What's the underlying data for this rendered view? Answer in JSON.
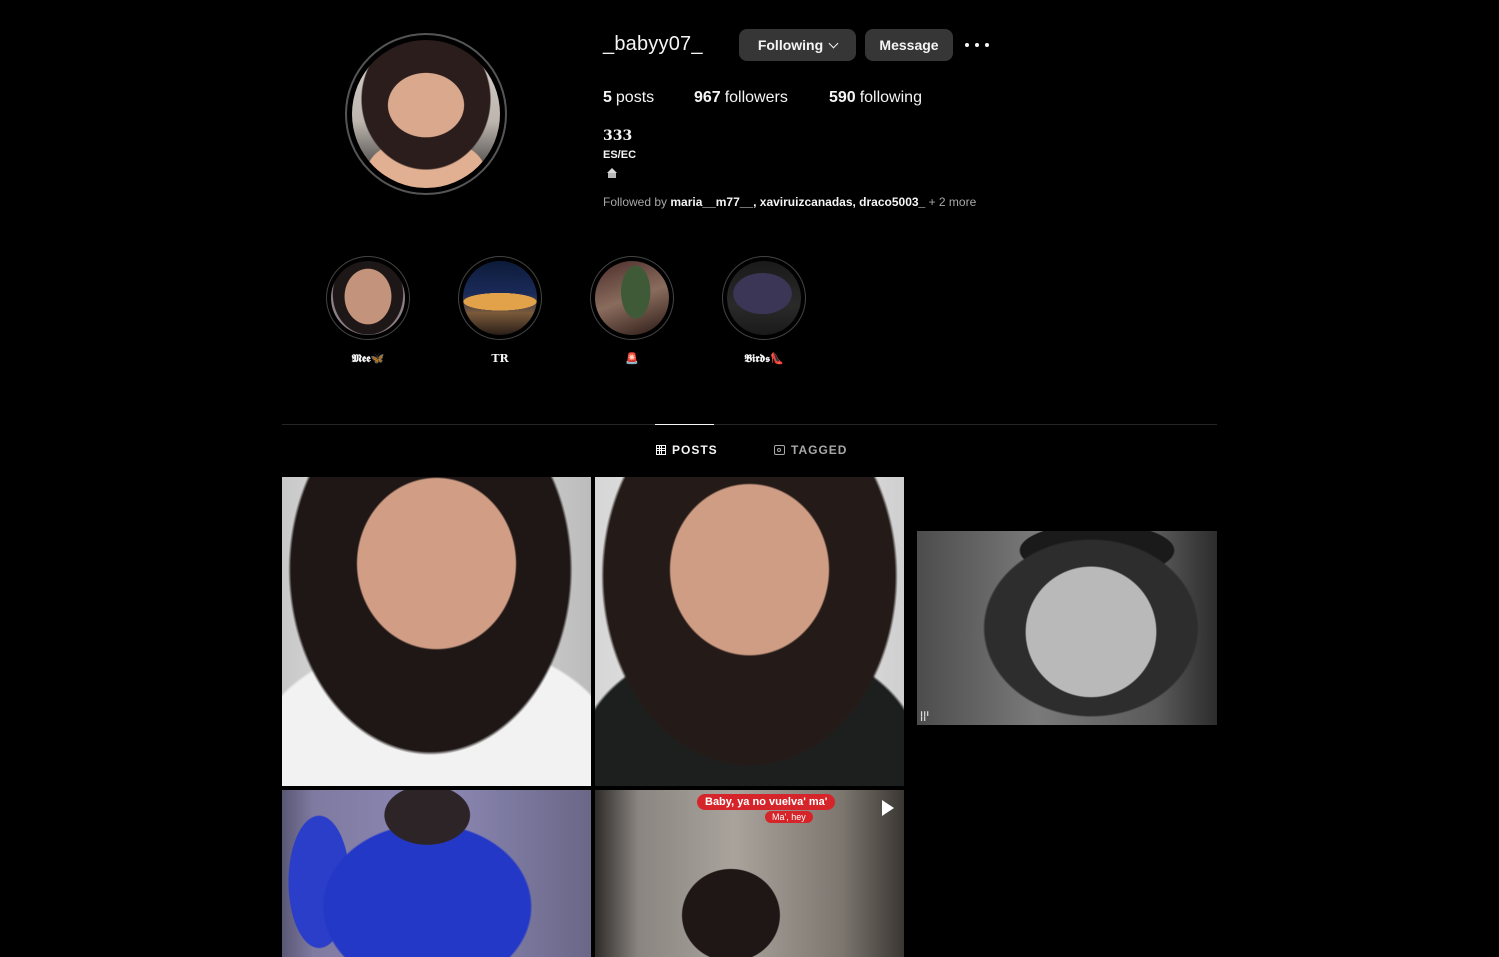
{
  "profile": {
    "username": "_babyy07_",
    "following_button": "Following",
    "message_button": "Message",
    "stats": [
      {
        "count": "5",
        "label": "posts"
      },
      {
        "count": "967",
        "label": "followers"
      },
      {
        "count": "590",
        "label": "following"
      }
    ],
    "bio_name": "333",
    "bio_line": "ES/EC",
    "followed_by": {
      "prefix": "Followed by",
      "users": "maria__m77__, xaviruizcanadas, draco5003_",
      "suffix": "+ 2 more"
    }
  },
  "highlights": [
    {
      "label": "𝕸𝖊𝖊🦋"
    },
    {
      "label": "TR"
    },
    {
      "label": "🚨"
    },
    {
      "label": "𝕭𝖎𝖗𝖉𝖘👠"
    }
  ],
  "tabs": {
    "posts": "POSTS",
    "tagged": "TAGGED"
  },
  "posts": {
    "p5_caption_line1": "Baby, ya no vuelva' ma'",
    "p5_caption_line2": "Ma', hey"
  },
  "colors": {
    "background": "#000000",
    "button": "#363636",
    "muted_text": "#a8a8a8",
    "caption_red": "#d5252a"
  }
}
